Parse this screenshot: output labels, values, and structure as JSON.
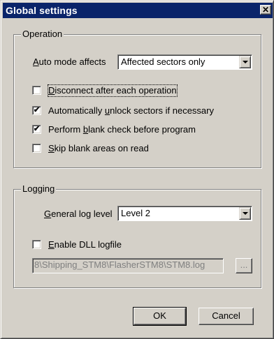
{
  "window": {
    "title": "Global settings",
    "close_glyph": "✕"
  },
  "operation": {
    "group_label": "Operation",
    "auto_mode_label_pre": "",
    "auto_mode_label_accel": "A",
    "auto_mode_label_post": "uto mode affects",
    "auto_mode_value": "Affected sectors only",
    "checkboxes": [
      {
        "pre": "",
        "accel": "D",
        "post": "isconnect after each operation",
        "checked": false,
        "mark": ""
      },
      {
        "pre": "Automatically ",
        "accel": "u",
        "post": "nlock sectors if necessary",
        "checked": true,
        "mark": "✔"
      },
      {
        "pre": "Perform ",
        "accel": "b",
        "post": "lank check before program",
        "checked": true,
        "mark": "✔"
      },
      {
        "pre": "",
        "accel": "S",
        "post": "kip blank areas on read",
        "checked": false,
        "mark": ""
      }
    ]
  },
  "logging": {
    "group_label": "Logging",
    "level_label_pre": "",
    "level_label_accel": "G",
    "level_label_post": "eneral log level",
    "level_value": "Level 2",
    "dll_pre": "",
    "dll_accel": "E",
    "dll_post": "nable DLL logfile",
    "dll_checked": false,
    "dll_mark": "",
    "logfile_path": "8\\Shipping_STM8\\FlasherSTM8\\STM8.log",
    "browse_label": "..."
  },
  "buttons": {
    "ok": "OK",
    "cancel": "Cancel"
  },
  "colors": {
    "titlebar": "#0a246a",
    "face": "#d4d0c8"
  }
}
